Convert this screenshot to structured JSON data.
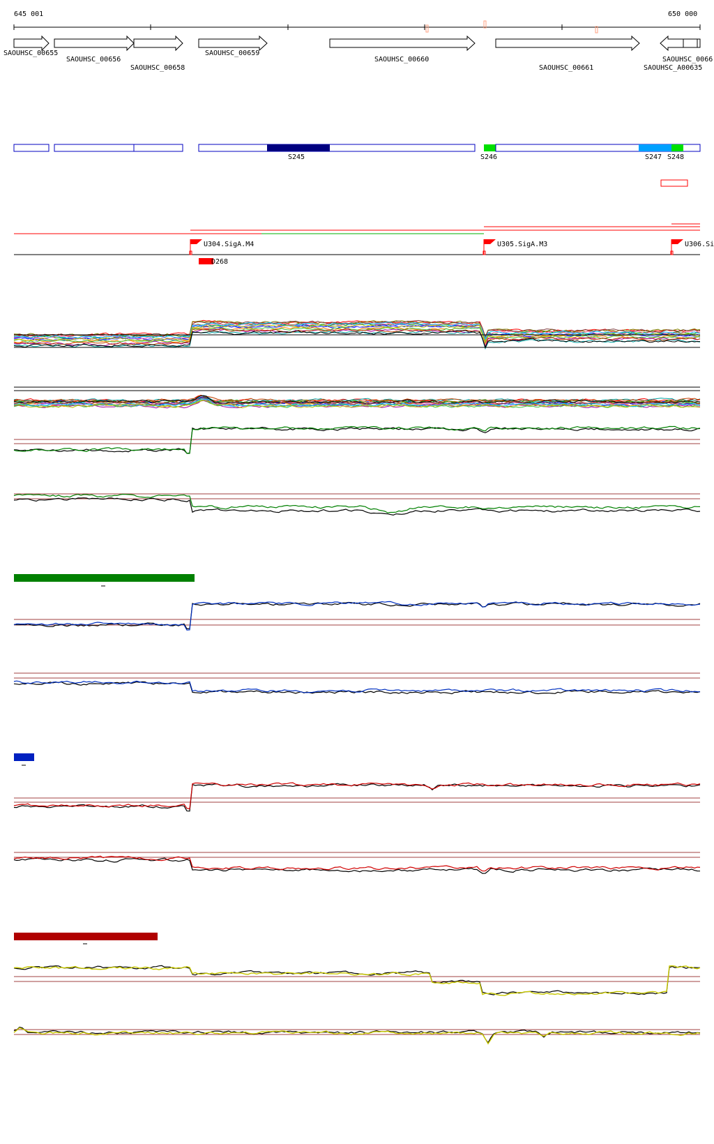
{
  "ruler": {
    "start_label": "645 001",
    "end_label": "650 000"
  },
  "genes": [
    {
      "label": "SAOUHSC_00655",
      "dir": "fwd"
    },
    {
      "label": "SAOUHSC_00656",
      "dir": "fwd"
    },
    {
      "label": "SAOUHSC_00658",
      "dir": "fwd"
    },
    {
      "label": "SAOUHSC_00659",
      "dir": "fwd"
    },
    {
      "label": "SAOUHSC_00660",
      "dir": "fwd"
    },
    {
      "label": "SAOUHSC_00661",
      "dir": "fwd"
    },
    {
      "label": "SAOUHSC_0066",
      "dir": "rev"
    },
    {
      "label": "SAOUHSC_A00635",
      "dir": "fwd"
    }
  ],
  "segments": [
    {
      "label": "S245",
      "color": "#000080"
    },
    {
      "label": "S246",
      "color": "#00e000"
    },
    {
      "label": "S247",
      "color": "#00a0ff"
    },
    {
      "label": "S248",
      "color": "#00e000"
    }
  ],
  "promoters": [
    {
      "label": "U304.SigA.M4"
    },
    {
      "label": "U305.SigA.M3"
    },
    {
      "label": "U306.Si"
    }
  ],
  "terminators": [
    {
      "label": "D268"
    }
  ],
  "condition_bars": [
    {
      "color": "#008000"
    },
    {
      "color": "#0020c0"
    },
    {
      "color": "#b00000"
    }
  ],
  "colors": {
    "gene_outline": "#000000",
    "segment_outline": "#0000c0",
    "feature_red": "#ff0000",
    "threshold": "#a04040",
    "green": "#008000",
    "blue": "#0030c0",
    "red": "#d00000",
    "yellow": "#c8c800",
    "black": "#000000"
  }
}
